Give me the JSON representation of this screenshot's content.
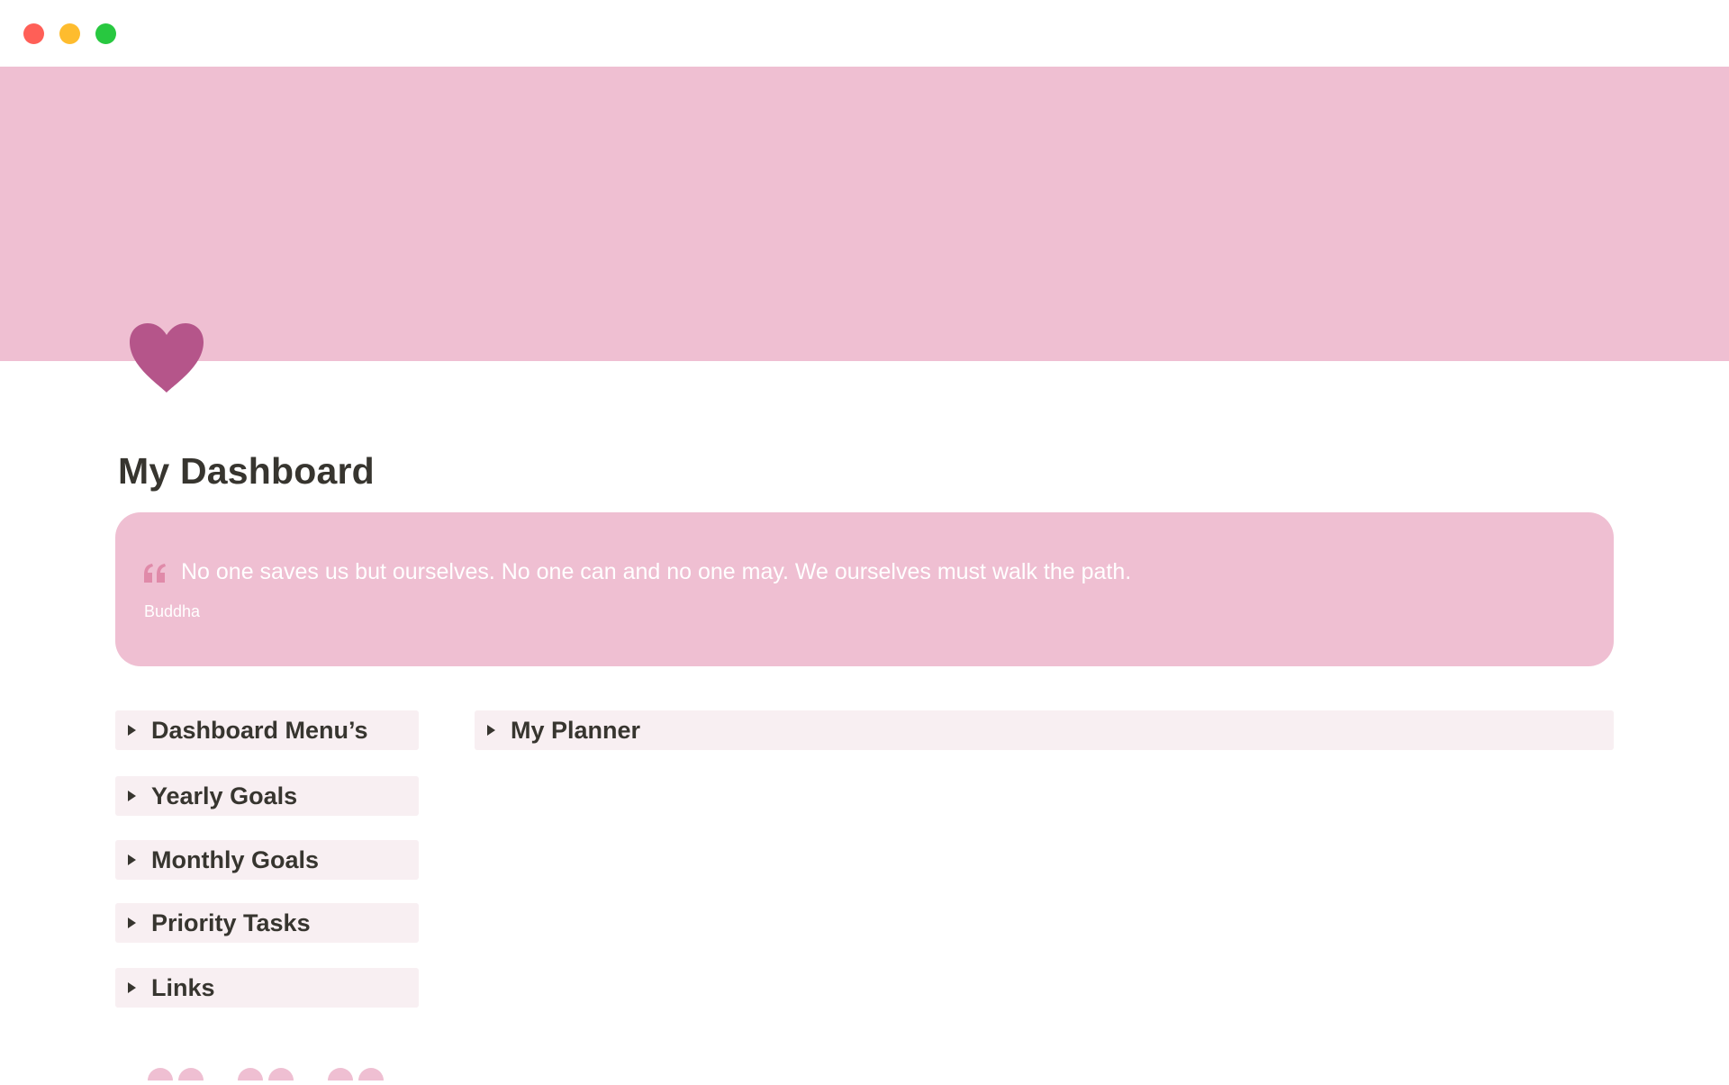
{
  "window": {
    "controls": [
      "close",
      "minimize",
      "maximize"
    ],
    "colors": {
      "close": "#ff5f57",
      "minimize": "#febc2e",
      "maximize": "#28c840"
    }
  },
  "cover": {
    "color": "#efbfd2"
  },
  "page": {
    "icon": "heart-icon",
    "icon_color": "#b5558a",
    "title": "My Dashboard"
  },
  "quote": {
    "icon": "quote-icon",
    "text": "No one saves us but ourselves. No one can and no one may. We ourselves must walk the path.",
    "author": "Buddha",
    "background": "#efbfd2"
  },
  "toggles": {
    "left": [
      {
        "label": "Dashboard Menu’s"
      },
      {
        "label": "Yearly Goals"
      },
      {
        "label": "Monthly Goals"
      },
      {
        "label": "Priority Tasks"
      },
      {
        "label": "Links"
      }
    ],
    "right": [
      {
        "label": "My Planner"
      }
    ],
    "background": "#f8eff2"
  }
}
